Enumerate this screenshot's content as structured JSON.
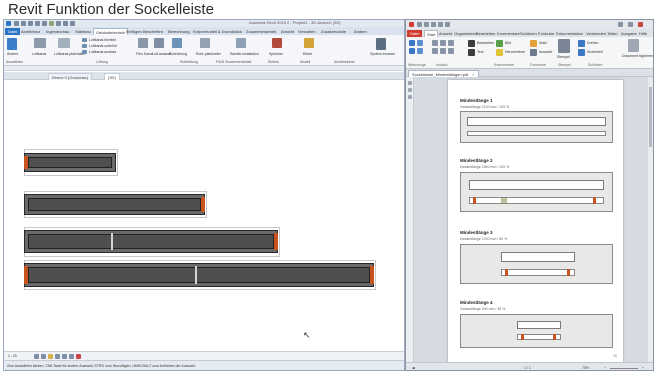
{
  "video_title": "Revit Funktion der Sockelleiste",
  "revit": {
    "window_title": "Autodesk Revit 2019.2 - Projekt1 - 3D-Ansicht: {3D}",
    "tabs": [
      "Datei",
      "Architektur",
      "Ingenieurbau",
      "Stahlbau",
      "Gebäudetechnik",
      "Einfügen",
      "Beschriften",
      "Berechnung",
      "Körpermodell & Grundstück",
      "Zusammenarbeit",
      "Ansicht",
      "Verwalten",
      "Zusatzmodule",
      "Ändern"
    ],
    "active_tab": "Gebäudetechnik",
    "ribbon": {
      "buttons": [
        "Ändern",
        "Luftkanal",
        "Luftkanal-platzhalter",
        "Luftkanal-formteil",
        "Luftkanal-zubehör",
        "Luftkanal-auslass",
        "Flex-Kanal",
        "Luft-auslass",
        "Rohrleitung",
        "Rohr-platzhalter",
        "Sanitär-installation",
        "Sprinkler",
        "Elektr.",
        "System-browser"
      ],
      "groups": [
        "Auswählen",
        "Lüftung",
        "Rohrleitung",
        "P&ID Zusammenarbeit",
        "Elektro",
        "Modell",
        "Arbeitsebene"
      ]
    },
    "view_tabs": [
      "Ebene 0 (Grundriss)",
      "{3D}"
    ],
    "active_view_tab": "{3D}",
    "view_scale": "1 : 20",
    "status": "Zum Auswählen klicken, TAB-Taste für andere Auswahl, STRG zum Hinzufügen, UMSCHALT zum Aufheben der Auswahl."
  },
  "pdf": {
    "tabs": [
      "Datei",
      "Start",
      "Ansicht",
      "Organisieren",
      "Bearbeiten",
      "Kommentare",
      "Schützen",
      "Formular",
      "Dokumentation",
      "Verwenden",
      "Teilen",
      "Ausgabe",
      "Hilfe"
    ],
    "active_tab": "Start",
    "ribbon_groups": [
      "Werkzeuge",
      "Ansicht",
      "Kommentare",
      "Formulare",
      "Stempel",
      "Schützen"
    ],
    "ribbon_labels": [
      "Bearbeiten",
      "Text",
      "Bild",
      "Hervorheben",
      "Notiz",
      "Auswahl",
      "Stempel",
      "Drehen",
      "Sicherheit",
      "Dokument signieren"
    ],
    "document_tab": "Sockelleiste_Mindestlängen.pdf",
    "sections": [
      {
        "title": "Mindestlänge 1",
        "subtitle": "Gesamtlänge 2100 mm / 100 %"
      },
      {
        "title": "Mindestlänge 2",
        "subtitle": "Gesamtlänge 1840 mm / 100 %"
      },
      {
        "title": "Mindestlänge 3",
        "subtitle": "Gesamtlänge 1200 mm / 60 %"
      },
      {
        "title": "Mindestlänge 4",
        "subtitle": "Gesamtlänge 940 mm / 45 %"
      }
    ],
    "page_number": "10",
    "status_page": "1 / 1",
    "zoom": "75%"
  },
  "colors": {
    "accent_orange": "#c7531f",
    "segment_fill": "#4f4f4f",
    "revit_blue": "#2b73c4",
    "pdf_red": "#d23b2f"
  }
}
